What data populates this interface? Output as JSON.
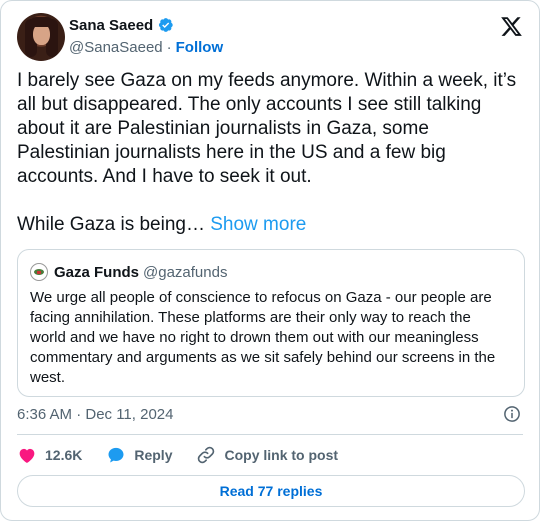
{
  "colors": {
    "link_blue": "#1d9bf0",
    "follow_blue": "#006fd6",
    "text_primary": "#0f1419",
    "text_secondary": "#536471",
    "heart_red": "#f91880",
    "border": "#cfd9de"
  },
  "author": {
    "display_name": "Sana Saeed",
    "handle": "@SanaSaeed",
    "separator": "·",
    "follow_label": "Follow",
    "verified_icon": "verified-badge-icon",
    "avatar_icon": "avatar"
  },
  "brand_icon": "x-logo-icon",
  "tweet": {
    "text": "I barely see Gaza on my feeds anymore. Within a week, it’s all but disappeared. The only accounts I see still talking about it are Palestinian journalists in Gaza, some Palestinian journalists here in the US and a few big accounts. And I have to seek it out.\n\nWhile Gaza is being…",
    "show_more": "Show more"
  },
  "quoted": {
    "display_name": "Gaza Funds",
    "handle": "@gazafunds",
    "text": "We urge all people of conscience to refocus on Gaza - our people are facing annihilation. These platforms are their only way to reach the world and we have no right to drown them out with our meaningless commentary and arguments as we sit safely behind our screens in the west."
  },
  "meta": {
    "timestamp": "6:36 AM · Dec 11, 2024",
    "info_icon": "info-icon"
  },
  "actions": {
    "like_count": "12.6K",
    "reply_label": "Reply",
    "copy_label": "Copy link to post",
    "like_icon": "heart-icon",
    "reply_icon": "reply-bubble-icon",
    "copy_icon": "link-icon"
  },
  "footer": {
    "read_replies": "Read 77 replies"
  }
}
